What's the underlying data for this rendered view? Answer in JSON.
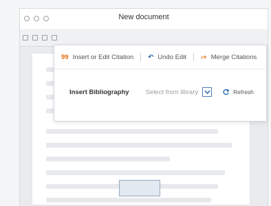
{
  "window": {
    "title": "New document"
  },
  "panel": {
    "insert_edit_label": "Insert or Edit Citation",
    "undo_label": "Undo Edit",
    "merge_label": "Merge Citations",
    "insert_bib_label": "Insert Bibliography",
    "select_placeholder": "Select from library",
    "refresh_label": "Refresh"
  },
  "colors": {
    "accent": "#e46c0a",
    "link": "#2b6cb0"
  }
}
